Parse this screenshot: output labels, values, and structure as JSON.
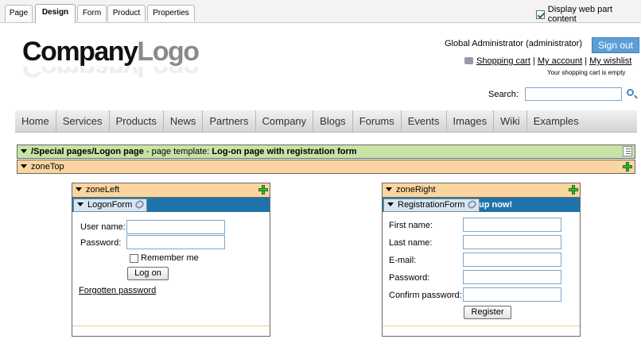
{
  "tabs": [
    {
      "label": "Page",
      "active": false
    },
    {
      "label": "Design",
      "active": true
    },
    {
      "label": "Form",
      "active": false
    },
    {
      "label": "Product",
      "active": false
    },
    {
      "label": "Properties",
      "active": false
    }
  ],
  "display_web_part_content": {
    "label": "Display web part content",
    "checked": true
  },
  "logo": {
    "company": "Company",
    "logo": "Logo"
  },
  "header": {
    "user": "Global Administrator (administrator)",
    "sign_out": "Sign out",
    "shopping_cart": "Shopping cart",
    "my_account": "My account",
    "my_wishlist": "My wishlist",
    "separator": "|",
    "cart_status": "Your shopping cart is empty",
    "search_label": "Search:",
    "search_value": ""
  },
  "menu": [
    "Home",
    "Services",
    "Products",
    "News",
    "Partners",
    "Company",
    "Blogs",
    "Forums",
    "Events",
    "Images",
    "Wiki",
    "Examples"
  ],
  "page_template": {
    "path": "/Special pages/Logon page",
    "separator": " - page template: ",
    "name": "Log-on page with registration form"
  },
  "zones": {
    "top": "zoneTop",
    "left": "zoneLeft",
    "right": "zoneRight"
  },
  "logon_form": {
    "webpart": "LogonForm",
    "user_name_label": "User name:",
    "password_label": "Password:",
    "remember_me": "Remember me",
    "remember_checked": false,
    "logon_button": "Log on",
    "forgotten_password": "Forgotten password"
  },
  "registration_form": {
    "webpart": "RegistrationForm",
    "header_fragment": "up now!",
    "first_name_label": "First name:",
    "last_name_label": "Last name:",
    "email_label": "E-mail:",
    "password_label": "Password:",
    "confirm_password_label": "Confirm password:",
    "register_button": "Register"
  },
  "colors": {
    "accent_blue": "#1f73a8",
    "template_green": "#c7e4a6",
    "zone_orange": "#fbd59f"
  }
}
